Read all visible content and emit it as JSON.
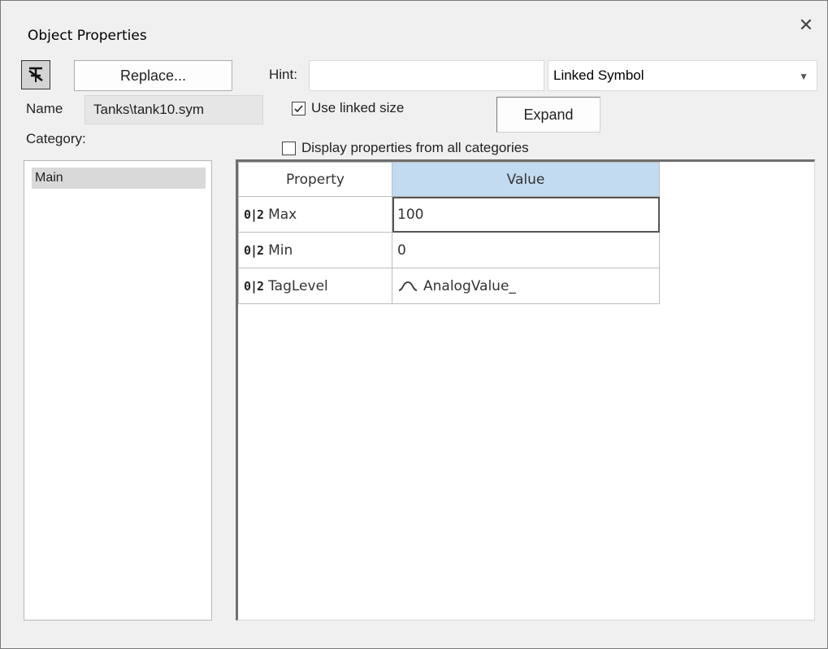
{
  "window": {
    "title": "Object Properties",
    "close_glyph": "✕"
  },
  "toolbar": {
    "pin_icon": "pushpin-icon",
    "replace_label": "Replace...",
    "hint_label": "Hint:",
    "hint_value": "",
    "symbol_combo_value": "Linked Symbol"
  },
  "name_row": {
    "name_label": "Name",
    "name_value": "Tanks\\tank10.sym",
    "use_linked_size_label": "Use linked size",
    "use_linked_size_checked": true,
    "expand_label": "Expand"
  },
  "category": {
    "label": "Category:",
    "display_all_label": "Display properties from all categories",
    "display_all_checked": false,
    "items": [
      {
        "label": "Main",
        "selected": true
      }
    ]
  },
  "grid": {
    "headers": {
      "property": "Property",
      "value": "Value"
    },
    "rows": [
      {
        "type_tag": "0|2",
        "property": "Max",
        "value": "100",
        "value_icon": "",
        "editing": true
      },
      {
        "type_tag": "0|2",
        "property": "Min",
        "value": "0",
        "value_icon": "",
        "editing": false
      },
      {
        "type_tag": "0|2",
        "property": "TagLevel",
        "value": "AnalogValue_",
        "value_icon": "wave-icon",
        "editing": false
      }
    ]
  },
  "colors": {
    "header_value_bg": "#c2dbf0",
    "selection_bg": "#d9d9d9",
    "dialog_bg": "#f0f0f0"
  }
}
